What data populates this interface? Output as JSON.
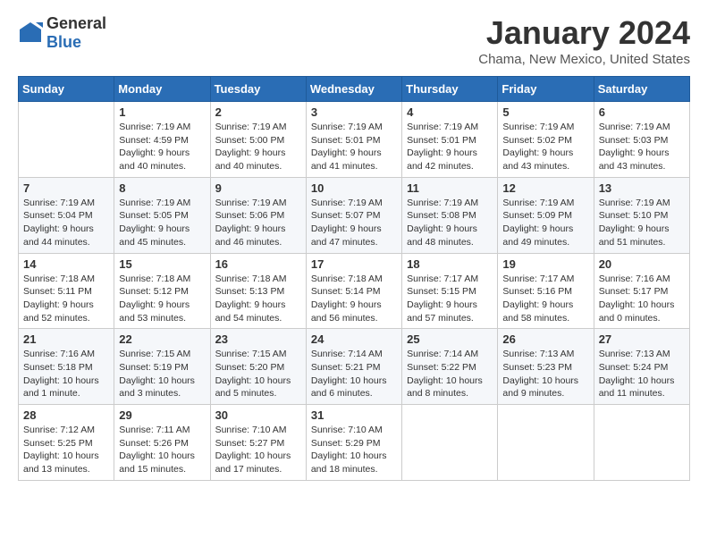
{
  "logo": {
    "general": "General",
    "blue": "Blue"
  },
  "title": "January 2024",
  "location": "Chama, New Mexico, United States",
  "days_of_week": [
    "Sunday",
    "Monday",
    "Tuesday",
    "Wednesday",
    "Thursday",
    "Friday",
    "Saturday"
  ],
  "weeks": [
    [
      {
        "day": "",
        "info": ""
      },
      {
        "day": "1",
        "info": "Sunrise: 7:19 AM\nSunset: 4:59 PM\nDaylight: 9 hours\nand 40 minutes."
      },
      {
        "day": "2",
        "info": "Sunrise: 7:19 AM\nSunset: 5:00 PM\nDaylight: 9 hours\nand 40 minutes."
      },
      {
        "day": "3",
        "info": "Sunrise: 7:19 AM\nSunset: 5:01 PM\nDaylight: 9 hours\nand 41 minutes."
      },
      {
        "day": "4",
        "info": "Sunrise: 7:19 AM\nSunset: 5:01 PM\nDaylight: 9 hours\nand 42 minutes."
      },
      {
        "day": "5",
        "info": "Sunrise: 7:19 AM\nSunset: 5:02 PM\nDaylight: 9 hours\nand 43 minutes."
      },
      {
        "day": "6",
        "info": "Sunrise: 7:19 AM\nSunset: 5:03 PM\nDaylight: 9 hours\nand 43 minutes."
      }
    ],
    [
      {
        "day": "7",
        "info": "Sunrise: 7:19 AM\nSunset: 5:04 PM\nDaylight: 9 hours\nand 44 minutes."
      },
      {
        "day": "8",
        "info": "Sunrise: 7:19 AM\nSunset: 5:05 PM\nDaylight: 9 hours\nand 45 minutes."
      },
      {
        "day": "9",
        "info": "Sunrise: 7:19 AM\nSunset: 5:06 PM\nDaylight: 9 hours\nand 46 minutes."
      },
      {
        "day": "10",
        "info": "Sunrise: 7:19 AM\nSunset: 5:07 PM\nDaylight: 9 hours\nand 47 minutes."
      },
      {
        "day": "11",
        "info": "Sunrise: 7:19 AM\nSunset: 5:08 PM\nDaylight: 9 hours\nand 48 minutes."
      },
      {
        "day": "12",
        "info": "Sunrise: 7:19 AM\nSunset: 5:09 PM\nDaylight: 9 hours\nand 49 minutes."
      },
      {
        "day": "13",
        "info": "Sunrise: 7:19 AM\nSunset: 5:10 PM\nDaylight: 9 hours\nand 51 minutes."
      }
    ],
    [
      {
        "day": "14",
        "info": "Sunrise: 7:18 AM\nSunset: 5:11 PM\nDaylight: 9 hours\nand 52 minutes."
      },
      {
        "day": "15",
        "info": "Sunrise: 7:18 AM\nSunset: 5:12 PM\nDaylight: 9 hours\nand 53 minutes."
      },
      {
        "day": "16",
        "info": "Sunrise: 7:18 AM\nSunset: 5:13 PM\nDaylight: 9 hours\nand 54 minutes."
      },
      {
        "day": "17",
        "info": "Sunrise: 7:18 AM\nSunset: 5:14 PM\nDaylight: 9 hours\nand 56 minutes."
      },
      {
        "day": "18",
        "info": "Sunrise: 7:17 AM\nSunset: 5:15 PM\nDaylight: 9 hours\nand 57 minutes."
      },
      {
        "day": "19",
        "info": "Sunrise: 7:17 AM\nSunset: 5:16 PM\nDaylight: 9 hours\nand 58 minutes."
      },
      {
        "day": "20",
        "info": "Sunrise: 7:16 AM\nSunset: 5:17 PM\nDaylight: 10 hours\nand 0 minutes."
      }
    ],
    [
      {
        "day": "21",
        "info": "Sunrise: 7:16 AM\nSunset: 5:18 PM\nDaylight: 10 hours\nand 1 minute."
      },
      {
        "day": "22",
        "info": "Sunrise: 7:15 AM\nSunset: 5:19 PM\nDaylight: 10 hours\nand 3 minutes."
      },
      {
        "day": "23",
        "info": "Sunrise: 7:15 AM\nSunset: 5:20 PM\nDaylight: 10 hours\nand 5 minutes."
      },
      {
        "day": "24",
        "info": "Sunrise: 7:14 AM\nSunset: 5:21 PM\nDaylight: 10 hours\nand 6 minutes."
      },
      {
        "day": "25",
        "info": "Sunrise: 7:14 AM\nSunset: 5:22 PM\nDaylight: 10 hours\nand 8 minutes."
      },
      {
        "day": "26",
        "info": "Sunrise: 7:13 AM\nSunset: 5:23 PM\nDaylight: 10 hours\nand 9 minutes."
      },
      {
        "day": "27",
        "info": "Sunrise: 7:13 AM\nSunset: 5:24 PM\nDaylight: 10 hours\nand 11 minutes."
      }
    ],
    [
      {
        "day": "28",
        "info": "Sunrise: 7:12 AM\nSunset: 5:25 PM\nDaylight: 10 hours\nand 13 minutes."
      },
      {
        "day": "29",
        "info": "Sunrise: 7:11 AM\nSunset: 5:26 PM\nDaylight: 10 hours\nand 15 minutes."
      },
      {
        "day": "30",
        "info": "Sunrise: 7:10 AM\nSunset: 5:27 PM\nDaylight: 10 hours\nand 17 minutes."
      },
      {
        "day": "31",
        "info": "Sunrise: 7:10 AM\nSunset: 5:29 PM\nDaylight: 10 hours\nand 18 minutes."
      },
      {
        "day": "",
        "info": ""
      },
      {
        "day": "",
        "info": ""
      },
      {
        "day": "",
        "info": ""
      }
    ]
  ]
}
